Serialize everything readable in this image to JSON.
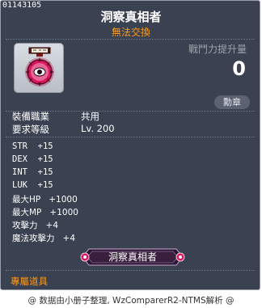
{
  "item": {
    "id": "01143105",
    "name": "洞察真相者",
    "trade": "無法交換",
    "power_label": "戰鬥力提升量",
    "power_value": "0",
    "medal_button": "勳章",
    "job_label": "裝備職業",
    "job_value": "共用",
    "level_label": "要求等級",
    "level_value": "Lv. 200",
    "stats": [
      {
        "name": "STR",
        "value": "+15"
      },
      {
        "name": "DEX",
        "value": "+15"
      },
      {
        "name": "INT",
        "value": "+15"
      },
      {
        "name": "LUK",
        "value": "+15"
      },
      {
        "name": "最大HP",
        "value": "+1000"
      },
      {
        "name": "最大MP",
        "value": "+1000"
      },
      {
        "name": "攻擊力",
        "value": "+4"
      },
      {
        "name": "魔法攻擊力",
        "value": "+4"
      }
    ],
    "medal_title": "洞察真相者",
    "exclusive": "專屬道具",
    "icon_name": "medal-icon"
  },
  "footer": "@ 数据由小册子整理, WzComparerR2-NTMS解析 @",
  "colors": {
    "background": "#3a4150",
    "accent": "#ff9a1a",
    "text": "#ffffff",
    "muted": "#9da2ab"
  }
}
